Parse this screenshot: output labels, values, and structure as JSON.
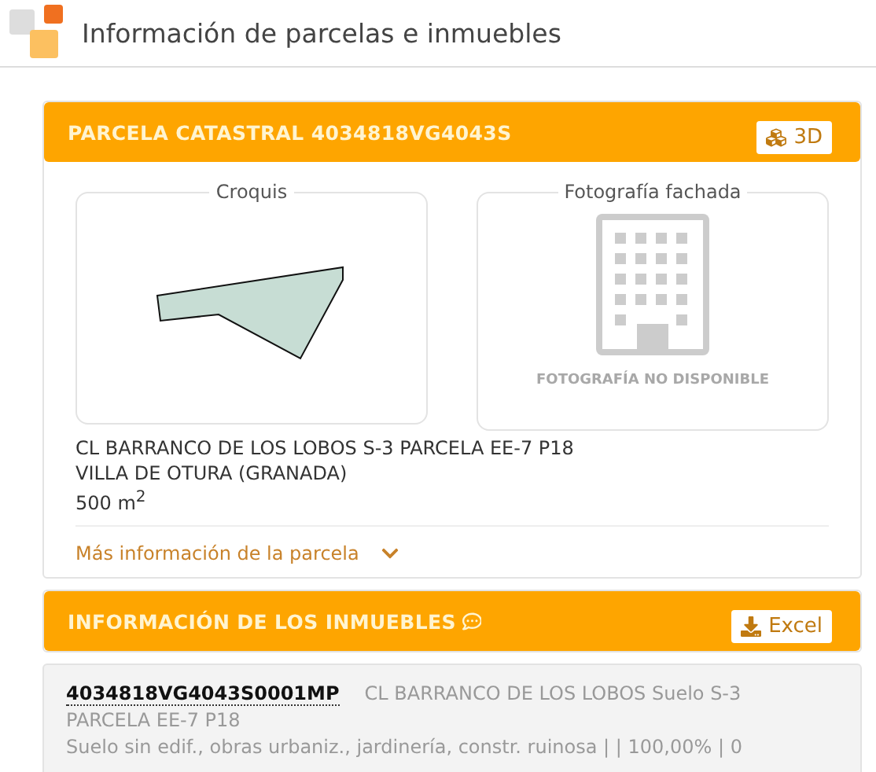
{
  "page_title": "Información de parcelas e inmuebles",
  "parcel": {
    "title": "PARCELA CATASTRAL 4034818VG4043S",
    "button_3d": "3D",
    "sketch_label": "Croquis",
    "photo_label": "Fotografía fachada",
    "photo_notice": "FOTOGRAFÍA NO DISPONIBLE",
    "address_lines": [
      "CL BARRANCO DE LOS LOBOS S-3 PARCELA EE-7 P18",
      "VILLA DE OTURA (GRANADA)"
    ],
    "area": "500 m$^{2}$",
    "more_link": "Más información de la parcela",
    "expanded": false
  },
  "properties": {
    "title": "INFORMACIÓN DE LOS INMUEBLES",
    "excel_button": "Excel",
    "items": [
      {
        "reference": "4034818VG4043S0001MP",
        "address": "CL BARRANCO DE LOS LOBOS Suelo S-3 PARCELA EE-7 P18",
        "details": "Suelo sin edif., obras urbaniz., jardinería, constr. ruinosa | | 100,00% | 0"
      }
    ]
  }
}
